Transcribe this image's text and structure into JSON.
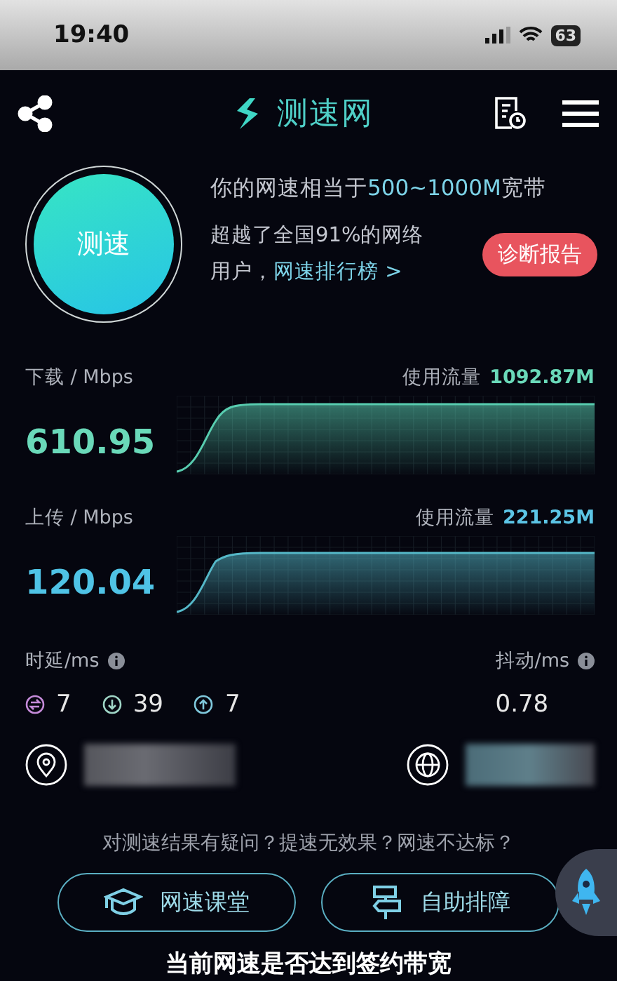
{
  "status_bar": {
    "time": "19:40",
    "battery": "63"
  },
  "header": {
    "title": "测速网"
  },
  "test_button": {
    "label": "测速"
  },
  "summary": {
    "prefix": "你的网速相当于",
    "highlight": "500~1000M",
    "suffix": "宽带"
  },
  "rank": {
    "line_1": "超越了全国91%的网络",
    "line_2": "用户，",
    "link": "网速排行榜 >"
  },
  "report_button": {
    "label": "诊断报告"
  },
  "speeds": [
    {
      "kind": "download",
      "label": "下载 / Mbps",
      "traffic_label": "使用流量",
      "traffic": "1092.87M",
      "value": "610.95"
    },
    {
      "kind": "upload",
      "label": "上传 / Mbps",
      "traffic_label": "使用流量",
      "traffic": "221.25M",
      "value": "120.04"
    }
  ],
  "latency": {
    "label": "时延/ms",
    "items": [
      {
        "kind": "idle",
        "value": "7"
      },
      {
        "kind": "download",
        "value": "39"
      },
      {
        "kind": "upload",
        "value": "7"
      }
    ]
  },
  "jitter": {
    "label": "抖动/ms",
    "value": "0.78"
  },
  "help": {
    "question": "对测速结果有疑问？提速无效果？网速不达标？",
    "buttons": [
      {
        "kind": "course",
        "label": "网速课堂"
      },
      {
        "kind": "troubleshoot",
        "label": "自助排障"
      }
    ]
  },
  "caption": "当前网速是否达到签约带宽"
}
